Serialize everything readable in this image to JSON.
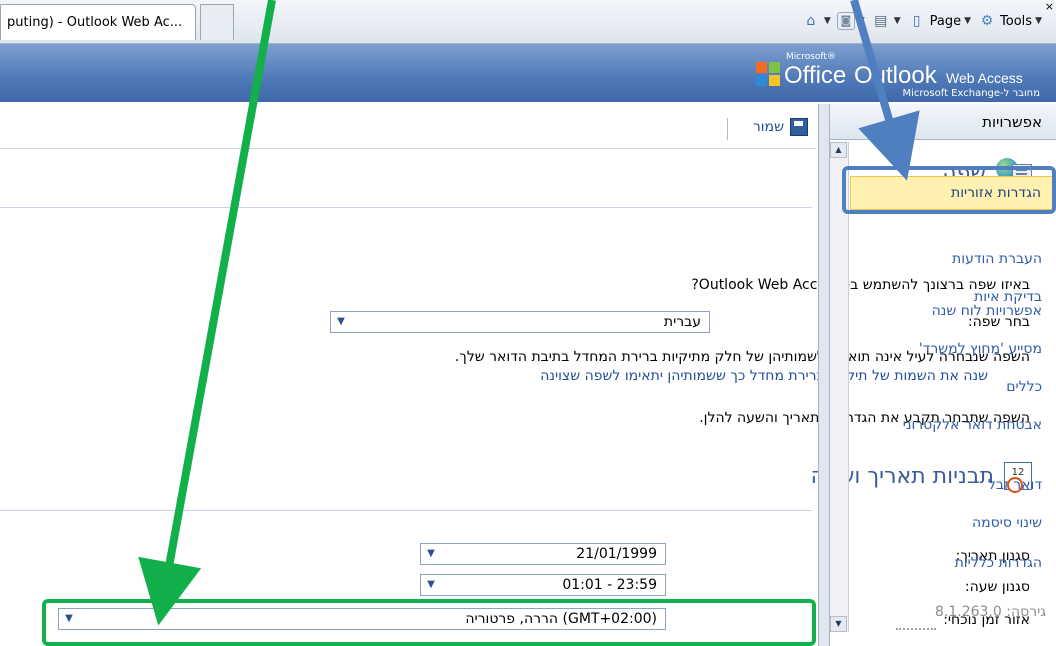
{
  "browser": {
    "tab_title": "puting) - Outlook Web Ac...",
    "toolbar": {
      "page_label": "Page",
      "tools_label": "Tools",
      "close_glyph": "×"
    }
  },
  "banner": {
    "logo_microsoft": "Microsoft®",
    "logo_office": "Office",
    "logo_outlook": "Outlook",
    "logo_web_access": "Web Access",
    "logo_subtitle": "מחובר ל-Microsoft Exchange"
  },
  "commandbar": {
    "save_label": "שמור"
  },
  "language": {
    "title": "שפה",
    "question": "באיזו שפה ברצונך להשתמש ב- Outlook Web Access?",
    "choose_label": "בחר שפה:",
    "choose_value": "עברית",
    "warning": "השפה שנבחרה לעיל אינה תואמת לשמותיהן של חלק מתיקיות ברירת המחדל בתיבת הדואר שלך.",
    "rename_link": "שנה את השמות של תיקיות ברירת מחדל כך ששמותיהן יתאימו לשפה שצוינה",
    "note": "השפה שתבחר תקבע את הגדרות התאריך והשעה להלן."
  },
  "datetime": {
    "title": "תבניות תאריך ושעה",
    "date_label": "סגנון תאריך:",
    "date_value": "21/01/1999",
    "time_label": "סגנון שעה:",
    "time_value": "01:01 - 23:59",
    "timezone_label": "אזור זמן נוכחי:",
    "timezone_value": "(GMT+02:00) הררה, פרטוריה"
  },
  "nav": {
    "header": "אפשרויות",
    "items": [
      {
        "label": "הגדרות אזוריות"
      },
      {
        "label": "העברת הודעות"
      },
      {
        "label": "בדיקת איות"
      },
      {
        "label": "אפשרויות לוח שנה"
      },
      {
        "label": "מסייע 'מחוץ למשרד'"
      },
      {
        "label": "כללים"
      },
      {
        "label": "אבטחת דואר אלקטרוני"
      },
      {
        "label": "דואר זבל"
      },
      {
        "label": "שינוי סיסמה"
      },
      {
        "label": "הגדרות כלליות"
      }
    ],
    "version": "גירסה: 8.1.263.0"
  },
  "icons": {
    "home": "home-icon",
    "feeds": "feeds-icon",
    "print": "print-icon",
    "page": "page-icon",
    "tools": "gear-icon",
    "save": "save-icon",
    "language": "language-icon",
    "calendar": "calendar-icon"
  },
  "colors": {
    "banner": "#4f79b8",
    "link": "#2f5ca8",
    "selected_bg": "#fff1b0",
    "annotation_green": "#12b04a",
    "annotation_blue": "#4f7fc0"
  }
}
